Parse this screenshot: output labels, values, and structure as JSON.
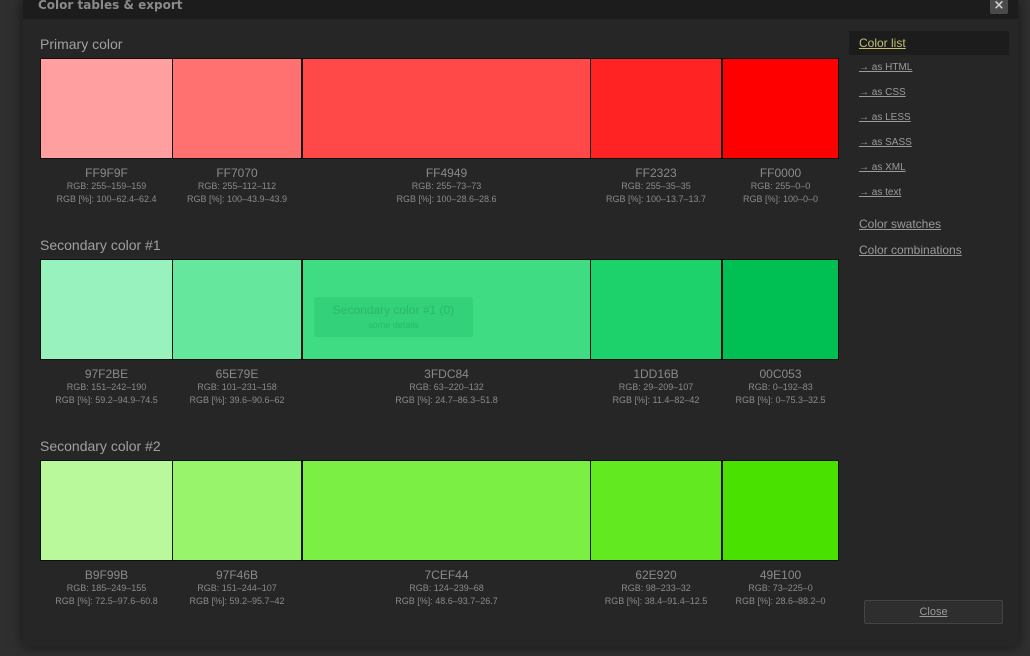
{
  "dialog": {
    "title": "Color tables & export",
    "close_icon": "×"
  },
  "sections": [
    {
      "title": "Primary color",
      "swatches": [
        {
          "hex": "FF9F9F",
          "color": "#FF9F9F",
          "rgb": "RGB: 255–159–159",
          "rgb_pct": "RGB [%]: 100–62.4–62.4"
        },
        {
          "hex": "FF7070",
          "color": "#FF7070",
          "rgb": "RGB: 255–112–112",
          "rgb_pct": "RGB [%]: 100–43.9–43.9"
        },
        {
          "hex": "FF4949",
          "color": "#FF4949",
          "rgb": "RGB: 255–73–73",
          "rgb_pct": "RGB [%]: 100–28.6–28.6"
        },
        {
          "hex": "FF2323",
          "color": "#FF2323",
          "rgb": "RGB: 255–35–35",
          "rgb_pct": "RGB [%]: 100–13.7–13.7"
        },
        {
          "hex": "FF0000",
          "color": "#FF0000",
          "rgb": "RGB: 255–0–0",
          "rgb_pct": "RGB [%]: 100–0–0"
        }
      ]
    },
    {
      "title": "Secondary color #1",
      "swatches": [
        {
          "hex": "97F2BE",
          "color": "#97F2BE",
          "rgb": "RGB: 151–242–190",
          "rgb_pct": "RGB [%]: 59.2–94.9–74.5"
        },
        {
          "hex": "65E79E",
          "color": "#65E79E",
          "rgb": "RGB: 101–231–158",
          "rgb_pct": "RGB [%]: 39.6–90.6–62"
        },
        {
          "hex": "3FDC84",
          "color": "#3FDC84",
          "rgb": "RGB: 63–220–132",
          "rgb_pct": "RGB [%]: 24.7–86.3–51.8"
        },
        {
          "hex": "1DD16B",
          "color": "#1DD16B",
          "rgb": "RGB: 29–209–107",
          "rgb_pct": "RGB [%]: 11.4–82–42"
        },
        {
          "hex": "00C053",
          "color": "#00C053",
          "rgb": "RGB: 0–192–83",
          "rgb_pct": "RGB [%]: 0–75.3–32.5"
        }
      ]
    },
    {
      "title": "Secondary color #2",
      "swatches": [
        {
          "hex": "B9F99B",
          "color": "#B9F99B",
          "rgb": "RGB: 185–249–155",
          "rgb_pct": "RGB [%]: 72.5–97.6–60.8"
        },
        {
          "hex": "97F46B",
          "color": "#97F46B",
          "rgb": "RGB: 151–244–107",
          "rgb_pct": "RGB [%]: 59.2–95.7–42"
        },
        {
          "hex": "7CEF44",
          "color": "#7CEF44",
          "rgb": "RGB: 124–239–68",
          "rgb_pct": "RGB [%]: 48.6–93.7–26.7"
        },
        {
          "hex": "62E920",
          "color": "#62E920",
          "rgb": "RGB: 98–233–32",
          "rgb_pct": "RGB [%]: 38.4–91.4–12.5"
        },
        {
          "hex": "49E100",
          "color": "#49E100",
          "rgb": "RGB: 73–225–0",
          "rgb_pct": "RGB [%]: 28.6–88.2–0"
        }
      ]
    }
  ],
  "tooltip": {
    "line1": "Secondary color #1 (0)",
    "line2": "some details"
  },
  "sidebar": {
    "color_list": "Color list",
    "exports": [
      "→ as HTML",
      "→ as CSS",
      "→ as LESS",
      "→ as SASS",
      "→ as XML",
      "→ as text"
    ],
    "color_swatches": "Color swatches",
    "color_combinations": "Color combinations"
  },
  "close_button": "Close",
  "colors": {
    "dialog_bg": "#262626",
    "active_link": "#c5c170"
  }
}
